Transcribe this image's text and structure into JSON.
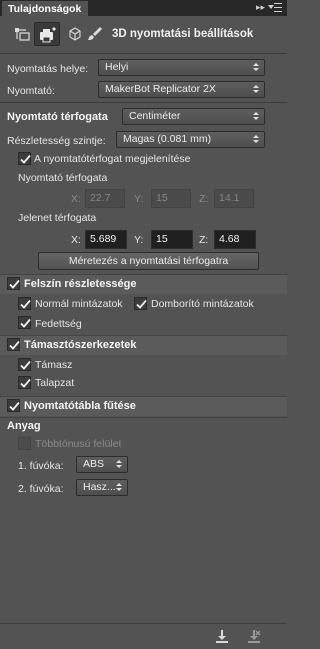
{
  "panel": {
    "tab_title": "Tulajdonságok",
    "collapse_glyph": "▸▸",
    "heading": "3D nyomtatási beállítások",
    "tools": [
      "mesh-icon",
      "printer-settings-icon",
      "cube-icon",
      "brush-icon"
    ]
  },
  "print_location": {
    "label": "Nyomtatás helye:",
    "value": "Helyi"
  },
  "printer": {
    "label": "Nyomtató:",
    "value": "MakerBot Replicator 2X"
  },
  "volume": {
    "title": "Nyomtató térfogata",
    "unit": "Centiméter",
    "detail_label": "Részletesség szintje:",
    "detail_value": "Magas   (0.081 mm)",
    "show_volume_label": "A nyomtatótérfogat megjelenítése",
    "show_volume_checked": true,
    "printer_volume_label": "Nyomtató térfogata",
    "printer_volume": {
      "x_label": "X:",
      "x": "22.7",
      "y_label": "Y:",
      "y": "15",
      "z_label": "Z:",
      "z": "14.1"
    },
    "scene_volume_label": "Jelenet térfogata",
    "scene_volume": {
      "x_label": "X:",
      "x": "5.689",
      "y_label": "Y:",
      "y": "15",
      "z_label": "Z:",
      "z": "4.68"
    },
    "scale_button": "Méretezés a nyomtatási térfogatra"
  },
  "surface": {
    "title": "Felszín részletessége",
    "checked": true,
    "normal_maps": "Normál mintázatok",
    "bump_maps": "Domborító mintázatok",
    "opacity": "Fedettség"
  },
  "supports": {
    "title": "Támasztószerkezetek",
    "checked": true,
    "scaffold": "Támasz",
    "raft": "Talapzat"
  },
  "heated_bed": {
    "title": "Nyomtatótábla fűtése",
    "checked": true
  },
  "material": {
    "title": "Anyag",
    "multitone_label": "Többtónusú felület",
    "nozzle1_label": "1. fúvóka:",
    "nozzle1_value": "ABS",
    "nozzle2_label": "2. fúvóka:",
    "nozzle2_value": "Hasz..."
  },
  "bottom_tools": [
    "print-icon",
    "cancel-print-icon"
  ]
}
